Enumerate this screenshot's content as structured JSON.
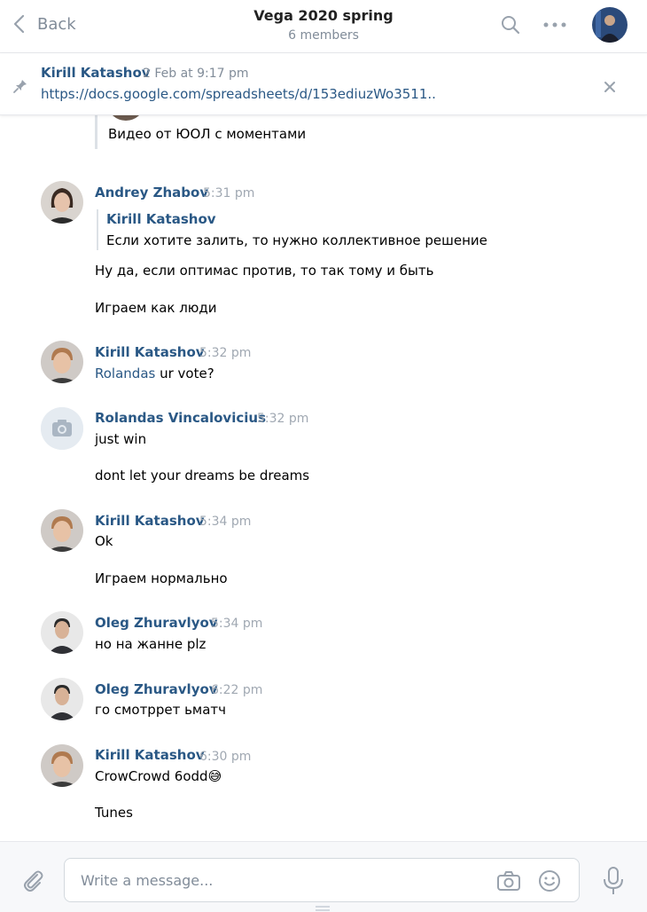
{
  "header": {
    "back_label": "Back",
    "title": "Vega 2020 spring",
    "subtitle": "6 members"
  },
  "pinned": {
    "author": "Kirill Katashov",
    "time": "2 Feb at 9:17 pm",
    "link": "https://docs.google.com/spreadsheets/d/153ediuzWo3511.."
  },
  "partial_message": {
    "text": "Видео от ЮОЛ с моментами"
  },
  "messages": [
    {
      "author": "Andrey Zhabov",
      "time": "5:31 pm",
      "quote_author": "Kirill Katashov",
      "quote_text": "Если хотите залить, то нужно коллективное решение",
      "lines": [
        "Ну да, если оптимас против, то так тому и быть",
        "Играем как люди"
      ]
    },
    {
      "author": "Kirill Katashov",
      "time": "5:32 pm",
      "mention": "Rolandas",
      "lines": [
        " ur vote?"
      ]
    },
    {
      "author": "Rolandas Vincalovicius",
      "time": "5:32 pm",
      "lines": [
        "just win",
        "dont let your dreams be dreams"
      ]
    },
    {
      "author": "Kirill Katashov",
      "time": "5:34 pm",
      "lines": [
        "Ok",
        "Играем нормально"
      ]
    },
    {
      "author": "Oleg Zhuravlyov",
      "time": "5:34 pm",
      "lines": [
        "но на жанне plz"
      ]
    },
    {
      "author": "Oleg Zhuravlyov",
      "time": "6:22 pm",
      "lines": [
        "го смотррет ьматч"
      ]
    },
    {
      "author": "Kirill Katashov",
      "time": "6:30 pm",
      "lines": [
        "CrowCrowd 6odd😅",
        "Tunes"
      ]
    }
  ],
  "composer": {
    "placeholder": "Write a message..."
  },
  "colors": {
    "link": "#2a5885",
    "muted": "#818c99",
    "border": "#e7e8ec"
  }
}
